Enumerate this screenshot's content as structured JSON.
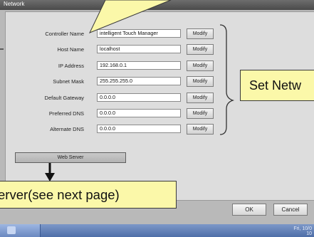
{
  "window": {
    "title": "Network"
  },
  "form": {
    "fields": [
      {
        "label": "Controller Name",
        "value": "intelligent Touch Manager",
        "button": "Modify"
      },
      {
        "label": "Host Name",
        "value": "localhost",
        "button": "Modify"
      },
      {
        "label": "IP Address",
        "value": "192.168.0.1",
        "button": "Modify"
      },
      {
        "label": "Subnet Mask",
        "value": "255.255.255.0",
        "button": "Modify"
      },
      {
        "label": "Default Gateway",
        "value": "0.0.0.0",
        "button": "Modify"
      },
      {
        "label": "Preferred DNS",
        "value": "0.0.0.0",
        "button": "Modify"
      },
      {
        "label": "Alternate DNS",
        "value": "0.0.0.0",
        "button": "Modify"
      }
    ],
    "web_server_button": "Web Server"
  },
  "footer": {
    "ok_label": "OK",
    "cancel_label": "Cancel"
  },
  "annotations": {
    "set_network": "Set Netw",
    "web_server_note": "erver(see next page)"
  },
  "taskbar": {
    "clock_line1": "Fri, 10/0",
    "clock_line2": "10"
  },
  "colors": {
    "callout_bg": "#fbf8a9",
    "panel_bg": "#dddddd",
    "titlebar_bg": "#4a4a4a",
    "taskbar_bg": "#4e6ea8"
  }
}
